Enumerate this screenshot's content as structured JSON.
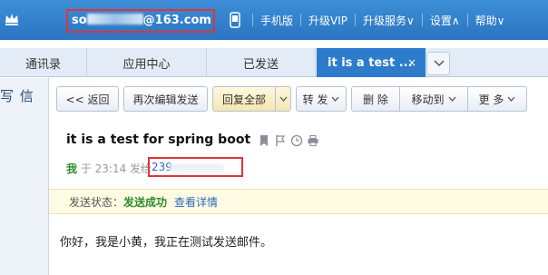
{
  "header": {
    "email_visible_prefix": "so",
    "email_visible_suffix": "@163.com",
    "nav": [
      "手机版",
      "升级VIP",
      "升级服务∨",
      "设置∧",
      "帮助∨"
    ]
  },
  "tabs": [
    {
      "label": "通讯录"
    },
    {
      "label": "应用中心"
    },
    {
      "label": "已发送"
    },
    {
      "label": "it is a test ...",
      "active": true
    }
  ],
  "tab_close": "×",
  "sidebar": {
    "compose_label": "写 信"
  },
  "toolbar": {
    "back": "<< 返回",
    "reedit": "再次编辑发送",
    "reply_all": "回复全部",
    "forward": "转 发",
    "delete": "删 除",
    "move_to": "移动到",
    "more": "更 多"
  },
  "message": {
    "subject": "it is a test for spring boot",
    "sender_label": "我",
    "sent_prefix": "于 23:14 发给",
    "recipient_visible": "239",
    "status_label": "发送状态：",
    "status_value": "发送成功",
    "details_link": "查看详情",
    "body": "你好，我是小黄，我正在测试发送邮件。"
  },
  "colors": {
    "topbar": "#2a74c1",
    "active_tab": "#2d7ccb",
    "highlight_box": "#e0333a",
    "success": "#2e8b2e",
    "link": "#2a6ab5"
  }
}
